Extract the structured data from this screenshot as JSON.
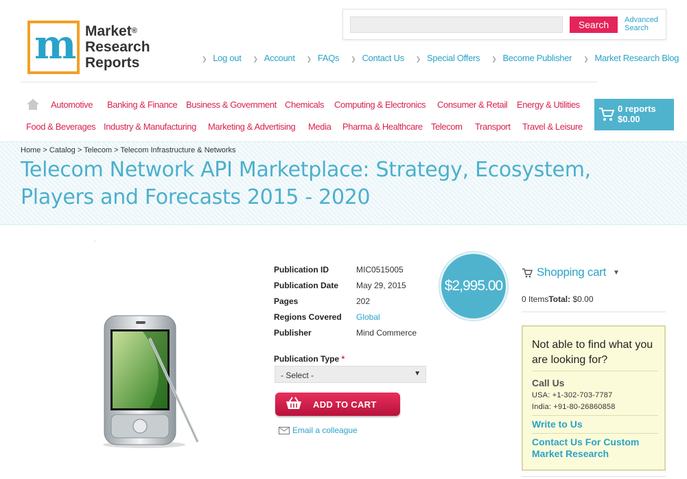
{
  "logo": {
    "line1": "Market",
    "line2": "Research",
    "line3": "Reports",
    "reg": "®"
  },
  "search": {
    "placeholder": "",
    "button": "Search",
    "advanced": "Advanced Search"
  },
  "top_links": [
    "Log out",
    "Account",
    "FAQs",
    "Contact Us",
    "Special Offers",
    "Become Publisher",
    "Market Research Blog"
  ],
  "categories_row1": [
    "Automotive",
    "Banking & Finance",
    "Business & Government",
    "Chemicals",
    "Computing & Electronics",
    "Consumer & Retail",
    "Energy & Utilities"
  ],
  "categories_row2": [
    "Food & Beverages",
    "Industry & Manufacturing",
    "Marketing & Advertising",
    "Media",
    "Pharma & Healthcare",
    "Telecom",
    "Transport",
    "Travel & Leisure"
  ],
  "cart": {
    "reports": "0 reports",
    "amount": "$0.00"
  },
  "breadcrumb": "Home > Catalog > Telecom > Telecom Infrastructure & Networks",
  "title": "Telecom Network API Marketplace: Strategy, Ecosystem, Players and Forecasts 2015 - 2020",
  "details": [
    {
      "label": "Publication ID",
      "value": "MIC0515005"
    },
    {
      "label": "Publication Date",
      "value": "May 29, 2015"
    },
    {
      "label": "Pages",
      "value": "202"
    },
    {
      "label": "Regions Covered",
      "value": "Global"
    },
    {
      "label": "Publisher",
      "value": "Mind Commerce"
    }
  ],
  "price": "$2,995.00",
  "pub_type": {
    "label": "Publication Type",
    "required": "*",
    "selected": "- Select -"
  },
  "add_to_cart": "ADD TO CART",
  "email_colleague": "Email a colleague",
  "shopping_cart": {
    "title": "Shopping cart",
    "items": "0 Items",
    "total_label": "Total:",
    "total": "$0.00"
  },
  "help": {
    "question": "Not able to find what you are looking for?",
    "call_us": "Call Us",
    "usa": "USA: +1-302-703-7787",
    "india": "India: +91-80-26860858",
    "write": "Write to Us",
    "custom": "Contact Us For Custom Market Research"
  },
  "colors": {
    "accent": "#4fb3ce",
    "category": "#d9234f",
    "link": "#2aa3c9"
  },
  "icons": [
    "home-icon",
    "cart-icon",
    "basket-icon",
    "envelope-icon",
    "chevron-down-icon"
  ]
}
